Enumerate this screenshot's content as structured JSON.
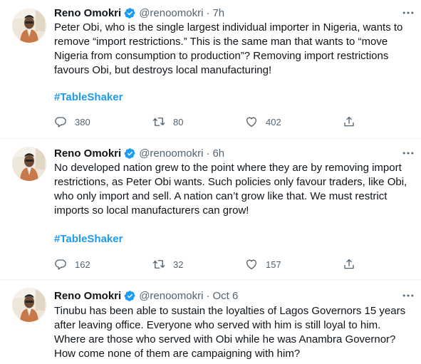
{
  "tweets": [
    {
      "author_name": "Reno Omokri",
      "handle": "@renoomokri",
      "time": "7h",
      "body_lines": [
        "Peter Obi, who is the single largest individual  importer in Nigeria, wants to",
        "remove “import restrictions.” This is the same man that wants to “move",
        "Nigeria from consumption to production”? Removing import restrictions",
        "favours Obi, but destroys local manufacturing!"
      ],
      "hashtag": "#TableShaker",
      "replies": "380",
      "retweets": "80",
      "likes": "402"
    },
    {
      "author_name": "Reno Omokri",
      "handle": "@renoomokri",
      "time": "6h",
      "body_lines": [
        "No developed nation grew to the point where they are by removing import",
        "restrictions, as Peter Obi wants. Such policies only favour traders, like Obi,",
        "who only import and sell. A nation can’t grow like that. We must restrict",
        "imports so local manufacturers can grow!"
      ],
      "hashtag": "#TableShaker",
      "replies": "162",
      "retweets": "32",
      "likes": "157"
    },
    {
      "author_name": "Reno Omokri",
      "handle": "@renoomokri",
      "time": "Oct 6",
      "body_lines": [
        "Tinubu has been able to sustain the loyalties of Lagos Governors 15 years",
        "after leaving office. Everyone who served with him is still loyal to him.",
        "Where are those who served with Obi while he was Anambra Governor?",
        "How come none of them are campaigning with him?"
      ]
    }
  ],
  "icons": {
    "verified": "verified-badge-icon",
    "more": "more-dots-icon",
    "reply": "reply-icon",
    "retweet": "retweet-icon",
    "like": "heart-icon",
    "share": "share-icon"
  },
  "colors": {
    "accent": "#1d9bf0",
    "text": "#0f1419",
    "muted": "#536471",
    "divider": "#eff3f4"
  }
}
